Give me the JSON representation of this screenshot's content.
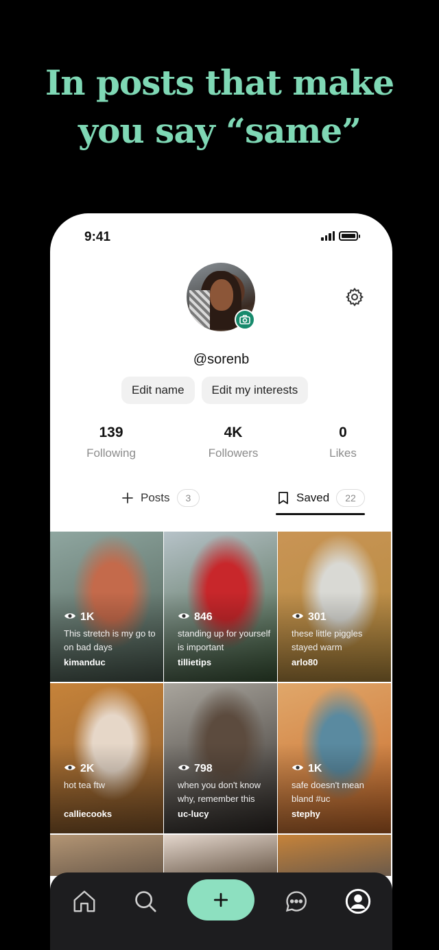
{
  "promo": {
    "line1": "In posts that make",
    "line2": "you say “same”",
    "accent_color": "#7fd8b5"
  },
  "status_bar": {
    "time": "9:41"
  },
  "profile": {
    "username": "@sorenb",
    "buttons": {
      "edit_name": "Edit name",
      "edit_interests": "Edit my interests"
    },
    "stats": [
      {
        "value": "139",
        "label": "Following"
      },
      {
        "value": "4K",
        "label": "Followers"
      },
      {
        "value": "0",
        "label": "Likes"
      }
    ]
  },
  "tabs": {
    "posts": {
      "label": "Posts",
      "count": "3"
    },
    "saved": {
      "label": "Saved",
      "count": "22",
      "active": true
    }
  },
  "posts": [
    {
      "views": "1K",
      "caption": "This stretch is my go to on bad days",
      "user": "kimanduc",
      "colors": [
        "#8fa6a0",
        "#c46a4b",
        "#4a5b50"
      ]
    },
    {
      "views": "846",
      "caption": "standing up for yourself is important",
      "user": "tillietips",
      "colors": [
        "#b6c2c8",
        "#c8272b",
        "#3d5a3a"
      ]
    },
    {
      "views": "301",
      "caption": "these little piggles stayed warm",
      "user": "arlo80",
      "colors": [
        "#c99455",
        "#d9d9d4",
        "#b38a3d"
      ]
    },
    {
      "views": "2K",
      "caption": "hot tea ftw",
      "user": "calliecooks",
      "colors": [
        "#c6833a",
        "#e6d7c8",
        "#8a5b2d"
      ]
    },
    {
      "views": "798",
      "caption": "when you don't know why, remember this",
      "user": "uc-lucy",
      "colors": [
        "#a9a59d",
        "#5c4b3e",
        "#2f2a27"
      ]
    },
    {
      "views": "1K",
      "caption": "safe doesn't mean bland #uc",
      "user": "stephy",
      "colors": [
        "#e0a76a",
        "#5a8aa0",
        "#c86a2a"
      ]
    }
  ],
  "partial_row_colors": [
    "#b39574",
    "#e3d6cc",
    "#c6833a"
  ],
  "nav": [
    "home-icon",
    "search-icon",
    "add-icon",
    "chat-icon",
    "profile-icon"
  ]
}
